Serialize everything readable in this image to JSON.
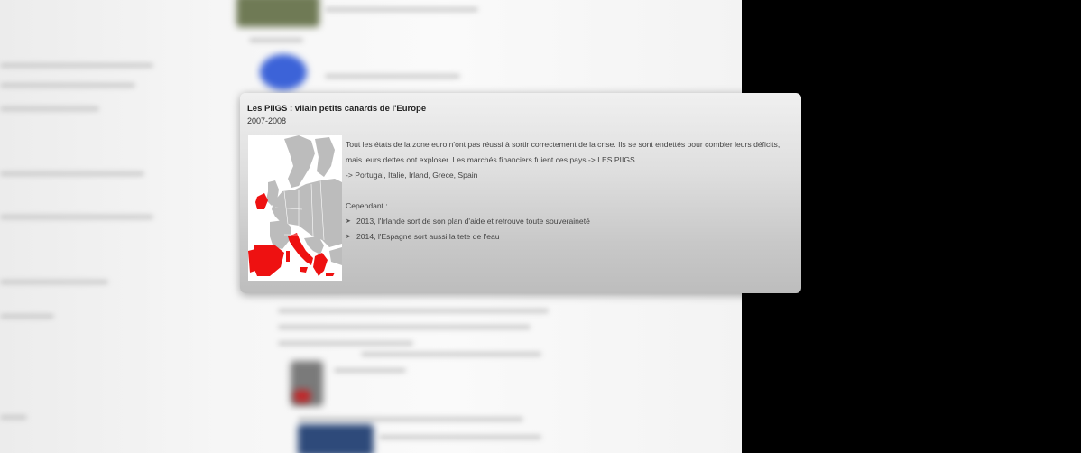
{
  "card": {
    "title": "Les PIIGS : vilain petits canards de l'Europe",
    "subtitle": "2007-2008",
    "paragraph": "Tout les états de la zone euro n'ont pas réussi à sortir correctement de la crise. Ils se sont endettés pour combler leurs déficits, mais leurs dettes ont exploser. Les marchés financiers fuient ces pays -> LES PIIGS",
    "countries_line": " -> Portugal, Italie, Irland, Grece, Spain",
    "cependant": "Cependant :",
    "bullets": [
      "2013, l'Irlande sort de son plan d'aide et retrouve toute souveraineté",
      "2014, l'Espagne sort aussi la tete de l'eau"
    ]
  },
  "map": {
    "highlight_color": "#ee1111",
    "base_color": "#bcbcbc",
    "highlighted": [
      "Portugal",
      "Italie",
      "Irland",
      "Grece",
      "Spain"
    ]
  }
}
